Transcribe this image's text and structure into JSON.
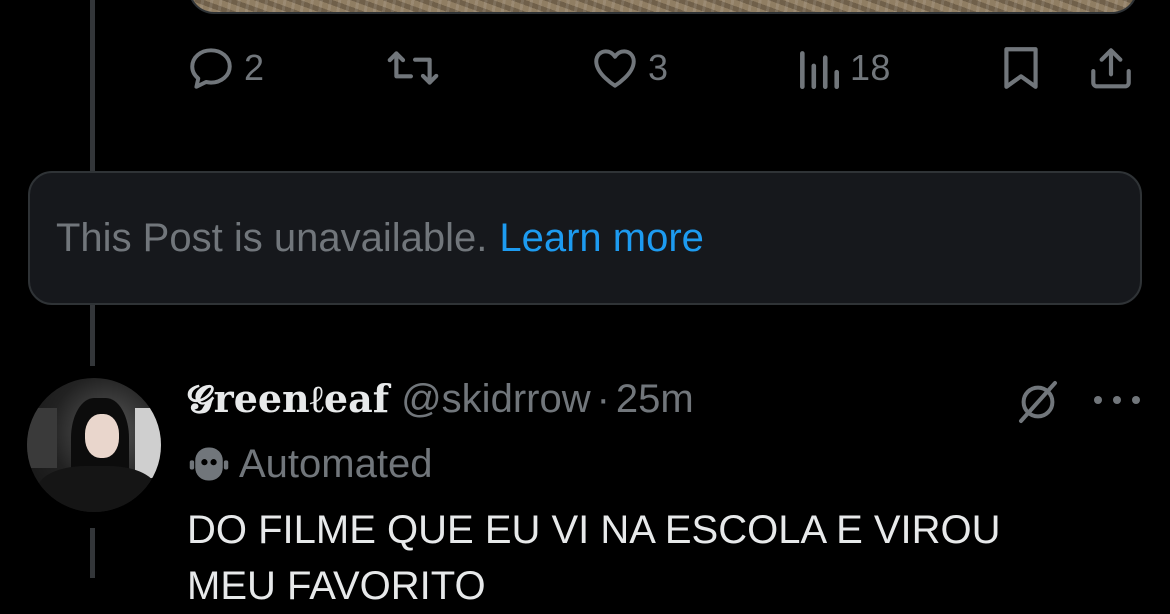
{
  "previous_post": {
    "actions": {
      "reply_count": "2",
      "repost_count": "",
      "like_count": "3",
      "views_count": "18"
    },
    "icons": {
      "reply": "reply-icon",
      "repost": "repost-icon",
      "like": "heart-icon",
      "views": "views-icon",
      "bookmark": "bookmark-icon",
      "share": "share-icon"
    }
  },
  "unavailable_notice": {
    "message": "This Post is unavailable.",
    "link_label": "Learn more",
    "link_color": "#1d9bf0"
  },
  "post": {
    "display_name": "𝓖reenℓeaf",
    "handle": "@skidrrow",
    "separator": "·",
    "time": "25m",
    "automated_label": "Automated",
    "text": "DO FILME QUE EU VI NA ESCOLA E VIROU\nMEU FAVORITO",
    "icons": {
      "grok": "grok-icon",
      "more": "more-icon",
      "automated": "robot-icon"
    }
  },
  "colors": {
    "background": "#000000",
    "secondary_text": "#71767b",
    "primary_text": "#e7e9ea",
    "card_background": "#16181c",
    "border": "#2f3336"
  }
}
